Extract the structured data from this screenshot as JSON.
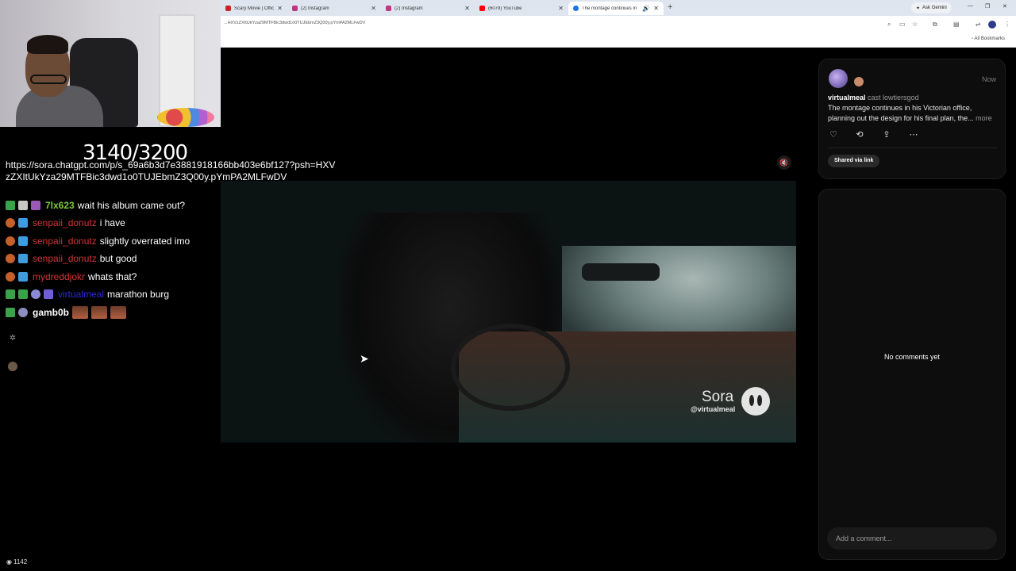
{
  "browser": {
    "tabs": [
      {
        "title": "Scary Movie | Official Tr",
        "favicon_color": "#cc2222",
        "active": false
      },
      {
        "title": "(2) Instagram",
        "favicon_color": "#c13584",
        "active": false
      },
      {
        "title": "(2) Instagram",
        "favicon_color": "#c13584",
        "active": false
      },
      {
        "title": "(6079) YouTube",
        "favicon_color": "#ff0000",
        "active": false
      },
      {
        "title": "The montage continues in",
        "favicon_color": "#1a73e8",
        "active": true
      }
    ],
    "ask_gemini_label": "Ask Gemini",
    "address": "...HXVzZXItUkYza29MTFBic3dwd1o0TUJEbmZ3Q00y.pYmPA2MLFwDV",
    "all_bookmarks_label": "All Bookmarks"
  },
  "stream_overlay": {
    "sub_goal": "3140/3200",
    "url_message": "https://sora.chatgpt.com/p/s_69a6b3d7e3881918166bb403e6bf127?psh=HXVzZXItUkYza29MTFBic3dwd1o0TUJEbmZ3Q00y.pYmPA2MLFwDV",
    "chat": [
      {
        "user": "7lx623",
        "user_color": "#7ec83f",
        "text": "wait his album came out?",
        "badges": [
          "#3aa34a",
          "#c7c7c7",
          "#9b59b6"
        ]
      },
      {
        "user": "senpaii_donutz",
        "user_color": "#d23434",
        "text": "i have",
        "badges": [
          "#c65f2a",
          "#3d9de0"
        ]
      },
      {
        "user": "senpaii_donutz",
        "user_color": "#d23434",
        "text": "slightly overrated imo",
        "badges": [
          "#c65f2a",
          "#3d9de0"
        ]
      },
      {
        "user": "senpaii_donutz",
        "user_color": "#d23434",
        "text": "but good",
        "badges": [
          "#c65f2a",
          "#3d9de0"
        ]
      },
      {
        "user": "mydreddjokr",
        "user_color": "#d23434",
        "text": "whats that?",
        "badges": [
          "#c65f2a",
          "#3d9de0"
        ]
      },
      {
        "user": "virtualmeal",
        "user_color": "#2b2bdc",
        "text": "marathon burg",
        "badges": [
          "#3aa34a",
          "#3aa34a",
          "#8a8ad6",
          "#6e5fd9"
        ]
      },
      {
        "user": "gamb0b",
        "user_color": "#ffffff",
        "text": "",
        "badges": [
          "#3aa34a",
          "#8c8cc0"
        ],
        "emotes": 3
      }
    ],
    "viewer_count": "1142"
  },
  "video": {
    "watermark": "Sora",
    "handle": "@virtualmeal"
  },
  "post": {
    "author": "virtualmeal",
    "cast_line": "cast lowtiersgod",
    "time": "Now",
    "body": "The montage continues in his Victorian office, planning out the design for his final plan, the...",
    "more_label": "more",
    "shared_label": "Shared via link"
  },
  "comments": {
    "empty_label": "No comments yet",
    "input_placeholder": "Add a comment..."
  }
}
